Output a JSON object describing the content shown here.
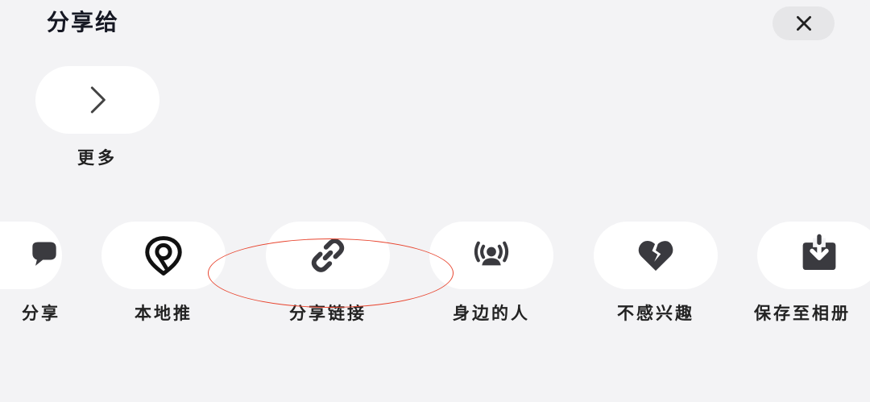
{
  "sheet": {
    "title": "分享给",
    "close_icon": "close-icon"
  },
  "top_row": {
    "more": {
      "label": "更多",
      "icon": "chevron-right-icon"
    }
  },
  "share_row": [
    {
      "label": "分享",
      "icon": "chat-bubble-icon"
    },
    {
      "label": "本地推",
      "icon": "location-pin-icon"
    },
    {
      "label": "分享链接",
      "icon": "link-icon"
    },
    {
      "label": "身边的人",
      "icon": "broadcast-person-icon"
    },
    {
      "label": "不感兴趣",
      "icon": "broken-heart-icon"
    },
    {
      "label": "保存至相册",
      "icon": "download-box-icon"
    }
  ],
  "colors": {
    "background": "#f3f3f5",
    "circle": "#ffffff",
    "icon": "#3a3a3f",
    "annotation": "#e8452f"
  }
}
